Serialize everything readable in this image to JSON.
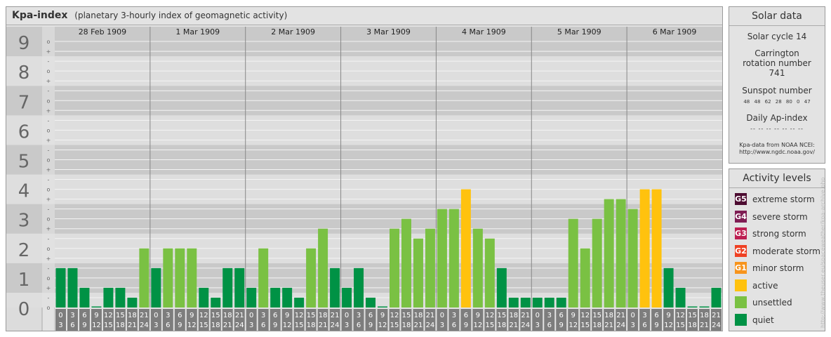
{
  "header": {
    "title": "Kpa-index",
    "subtitle": "(planetary 3-hourly index of geomagnetic activity)"
  },
  "chart_data": {
    "type": "bar",
    "title": "Kpa-index",
    "ylim": [
      0,
      9
    ],
    "y_ticks": [
      "0",
      "1",
      "2",
      "3",
      "4",
      "5",
      "6",
      "7",
      "8",
      "9"
    ],
    "sub_ticks": [
      "+",
      "o",
      "-"
    ],
    "days": [
      "28 Feb 1909",
      "1 Mar 1909",
      "2 Mar 1909",
      "3 Mar 1909",
      "4 Mar 1909",
      "5 Mar 1909",
      "6 Mar 1909"
    ],
    "hour_top": [
      "0",
      "3",
      "6",
      "9",
      "12",
      "15",
      "18",
      "21"
    ],
    "hour_bottom": [
      "3",
      "6",
      "9",
      "12",
      "15",
      "18",
      "21",
      "24"
    ],
    "values": [
      1.333,
      1.333,
      0.667,
      0.0,
      0.667,
      0.667,
      0.333,
      2.0,
      1.333,
      2.0,
      2.0,
      2.0,
      0.667,
      0.333,
      1.333,
      1.333,
      0.667,
      2.0,
      0.667,
      0.667,
      0.333,
      2.0,
      2.667,
      1.333,
      0.667,
      1.333,
      0.333,
      0.0,
      2.667,
      3.0,
      2.333,
      2.667,
      3.333,
      3.333,
      4.0,
      2.667,
      2.333,
      1.333,
      0.333,
      0.333,
      0.333,
      0.333,
      0.333,
      3.0,
      2.0,
      3.0,
      3.667,
      3.667,
      3.333,
      4.0,
      4.0,
      1.333,
      0.667,
      0.0,
      0.0,
      0.667
    ],
    "colors": {
      "quiet": "#009245",
      "unsettled": "#7ac143",
      "active": "#ffc20e",
      "g1": "#f7941d",
      "g2": "#ef4123",
      "g3": "#bd1e51",
      "g4": "#7f1d53",
      "g5": "#4d0c31"
    }
  },
  "solar": {
    "heading": "Solar data",
    "cycle": "Solar cycle 14",
    "carrington": "Carrington rotation number 741",
    "sunspot_label": "Sunspot number",
    "sunspot_values": [
      "48",
      "48",
      "62",
      "28",
      "80",
      "0",
      "47"
    ],
    "ap_label": "Daily Ap-index",
    "ap_values": [
      "--",
      "--",
      "--",
      "--",
      "--",
      "--",
      "--"
    ],
    "source_line1": "Kpa-data from NOAA NCEI:",
    "source_line2": "http://www.ngdc.noaa.gov/"
  },
  "activity": {
    "heading": "Activity levels",
    "levels": [
      {
        "badge": "G5",
        "label": "extreme storm",
        "color": "#4d0c31"
      },
      {
        "badge": "G4",
        "label": "severe storm",
        "color": "#7f1d53"
      },
      {
        "badge": "G3",
        "label": "strong storm",
        "color": "#bd1e51"
      },
      {
        "badge": "G2",
        "label": "moderate storm",
        "color": "#ef4123"
      },
      {
        "badge": "G1",
        "label": "minor storm",
        "color": "#f7941d"
      },
      {
        "badge": "",
        "label": "active",
        "color": "#ffc20e"
      },
      {
        "badge": "",
        "label": "unsettled",
        "color": "#7ac143"
      },
      {
        "badge": "",
        "label": "quiet",
        "color": "#009245"
      }
    ]
  },
  "watermark": "http://www.theuser.eu/spaceweather/kpa-archive.php"
}
